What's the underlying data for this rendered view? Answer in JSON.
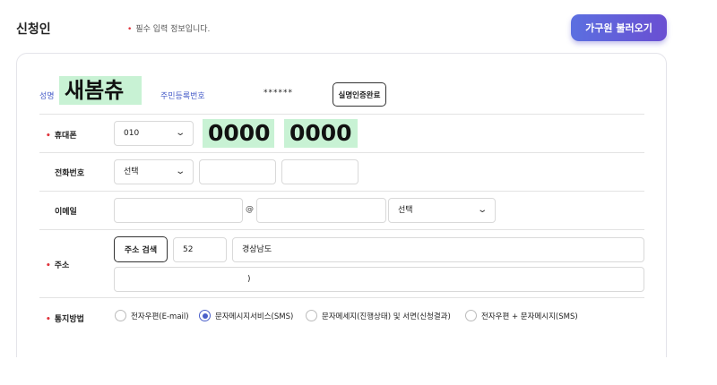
{
  "header": {
    "title": "신청인",
    "required_note": "필수 입력 정보입니다.",
    "family_button": "가구원 불러오기"
  },
  "colors": {
    "accent": "#4a5fc9",
    "required": "#e0343c",
    "highlight": "#c8f2d4"
  },
  "applicant": {
    "name_label": "성명",
    "name_value": "새봄츄",
    "rrn_label": "주민등록번호",
    "rrn_value": "******",
    "verify_button": "실명인증완료"
  },
  "mobile": {
    "label": "휴대폰",
    "prefix": "010",
    "middle": "0000",
    "last": "0000"
  },
  "phone": {
    "label": "전화번호",
    "area_placeholder": "선택",
    "middle": "",
    "last": ""
  },
  "email": {
    "label": "이메일",
    "id": "",
    "at": "@",
    "domain": "",
    "domain_select": "선택"
  },
  "address": {
    "label": "주소",
    "search_button": "주소 검색",
    "postcode": "52",
    "address1": "경상남도",
    "address2": ")"
  },
  "notify": {
    "label": "통지방법",
    "options": [
      {
        "label": "전자우편(E-mail)",
        "selected": false
      },
      {
        "label": "문자메시지서비스(SMS)",
        "selected": true
      },
      {
        "label": "문자메세지(진행상태) 및 서면(신청결과)",
        "selected": false
      },
      {
        "label": "전자우편 + 문자메시지(SMS)",
        "selected": false
      }
    ]
  }
}
